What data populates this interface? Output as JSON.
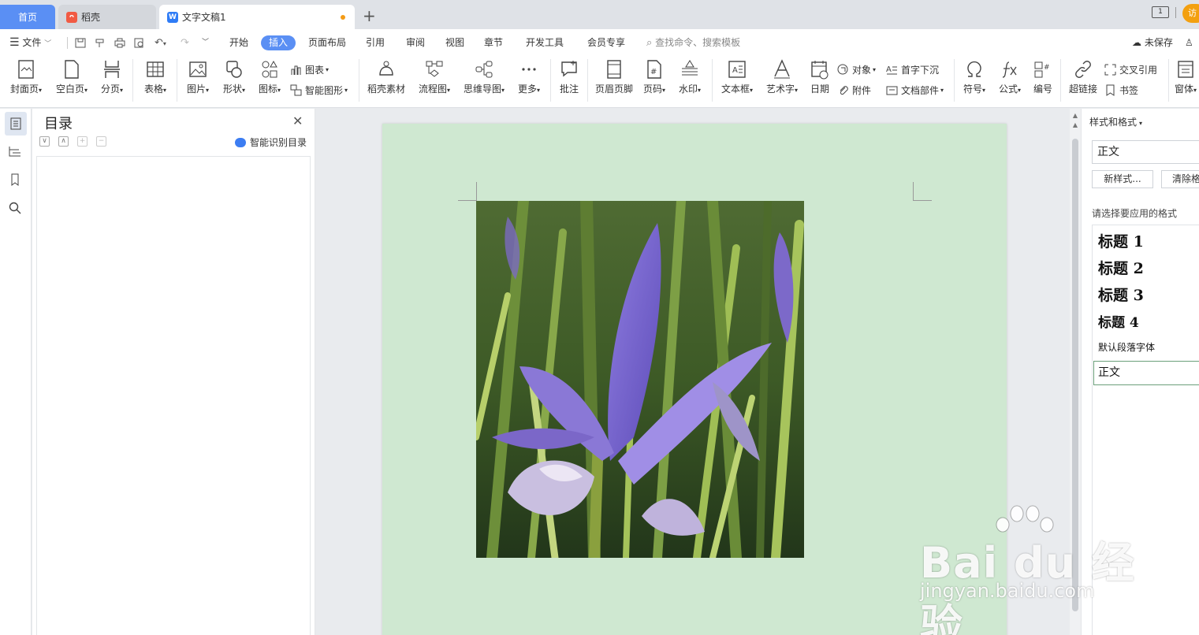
{
  "tabs": {
    "home": "首页",
    "daoke": "稻壳",
    "doc": "文字文稿1",
    "visit": "访"
  },
  "menu": {
    "file": "文件",
    "items": [
      "开始",
      "插入",
      "页面布局",
      "引用",
      "审阅",
      "视图",
      "章节",
      "开发工具",
      "会员专享"
    ],
    "active_item": "插入",
    "search_placeholder": "查找命令、搜索模板",
    "unsaved": "未保存"
  },
  "ribbon": {
    "cover_page": "封面页",
    "blank_page": "空白页",
    "page_break": "分页",
    "table": "表格",
    "picture": "图片",
    "shape": "形状",
    "icon": "图标",
    "chart": "图表",
    "smart_shape": "智能图形",
    "daoke_material": "稻壳素材",
    "flowchart": "流程图",
    "mind_map": "思维导图",
    "more": "更多",
    "comment": "批注",
    "header_footer": "页眉页脚",
    "page_number": "页码",
    "watermark": "水印",
    "text_box": "文本框",
    "word_art": "艺术字",
    "date": "日期",
    "object": "对象",
    "attachment": "附件",
    "drop_cap": "首字下沉",
    "doc_parts": "文档部件",
    "symbol": "符号",
    "formula": "公式",
    "numbering": "编号",
    "hyperlink": "超链接",
    "cross_reference": "交叉引用",
    "bookmark": "书签",
    "window": "窗体"
  },
  "toc": {
    "title": "目录",
    "smart_recognize": "智能识别目录"
  },
  "styles_pane": {
    "title": "样式和格式",
    "current_style": "正文",
    "new_style": "新样式...",
    "clear_format": "清除格式",
    "hint": "请选择要应用的格式",
    "items": [
      "标题 1",
      "标题 2",
      "标题 3",
      "标题 4",
      "默认段落字体",
      "正文"
    ]
  },
  "watermark": {
    "brand": "Bai du 经验",
    "url": "jingyan.baidu.com"
  },
  "colors": {
    "accent": "#5a8ff4",
    "page_background": "#cfe8d1",
    "unsaved_dot": "#f49b15"
  }
}
